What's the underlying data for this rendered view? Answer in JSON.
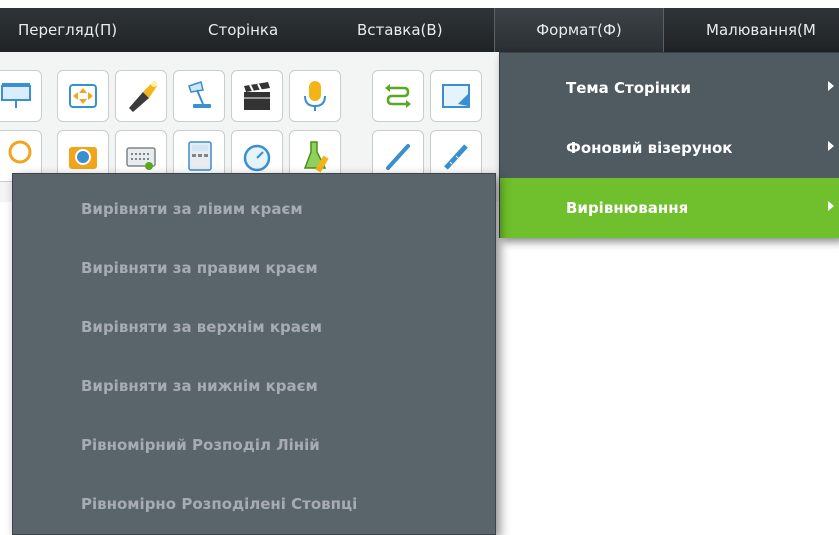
{
  "menubar": {
    "items": [
      {
        "label": "Перегляд(П)"
      },
      {
        "label": "Сторінка"
      },
      {
        "label": "Вставка(В)"
      },
      {
        "label": "Формат(Ф)"
      },
      {
        "label": "Малювання(М"
      }
    ]
  },
  "format_menu": {
    "items": [
      {
        "label": "Тема Сторінки"
      },
      {
        "label": "Фоновий візерунок"
      },
      {
        "label": "Вирівнювання"
      }
    ]
  },
  "align_submenu": {
    "items": [
      {
        "label": "Вирівняти за лівим краєм"
      },
      {
        "label": "Вирівняти за правим краєм"
      },
      {
        "label": "Вирівняти за верхнім краєм"
      },
      {
        "label": "Вирівняти за нижнім краєм"
      },
      {
        "label": "Рівномірний Розподіл Ліній"
      },
      {
        "label": "Рівномірно Розподілені Стовпці"
      }
    ]
  },
  "colors": {
    "menubar_bg": "#25292c",
    "menu_bg": "#4f5a61",
    "submenu_bg": "#5a646b",
    "highlight": "#6fc02c",
    "submenu_text": "#a6adb2"
  },
  "toolbar_icons": [
    "projector-screen-icon",
    "fit-screen-icon",
    "flashlight-icon",
    "desk-lamp-icon",
    "clapperboard-icon",
    "microphone-icon",
    "swap-arrows-icon",
    "screen-shape-icon",
    "magnifier-icon",
    "camera-icon",
    "keyboard-icon",
    "calculator-icon",
    "stopwatch-icon",
    "flask-ruler-icon",
    "pen-icon",
    "ruler-icon"
  ]
}
